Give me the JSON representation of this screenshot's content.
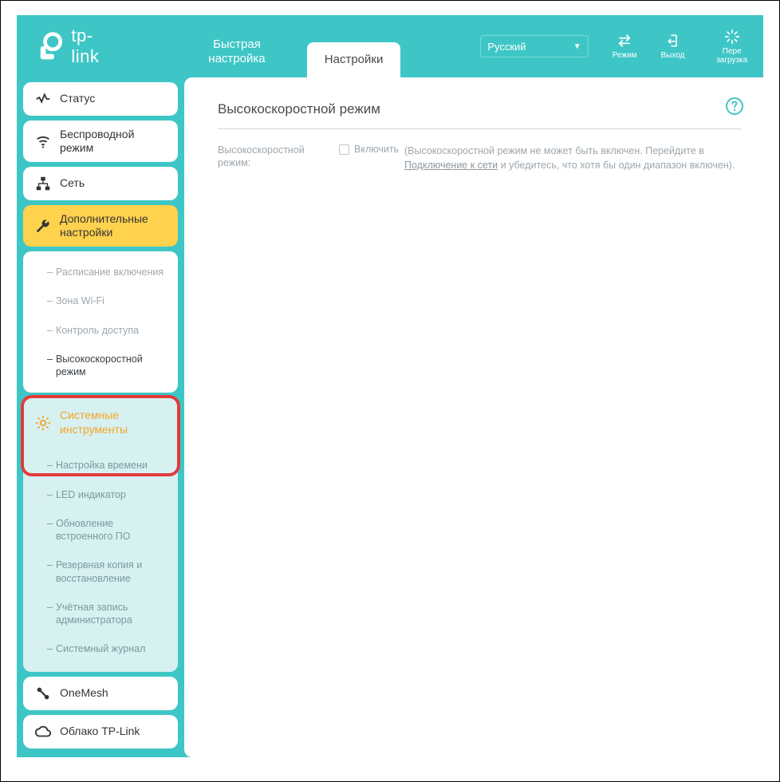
{
  "header": {
    "logo_text": "tp-link",
    "tabs": {
      "quick": "Быстрая настройка",
      "settings": "Настройки"
    },
    "language": "Русский",
    "icons": {
      "mode": "Режим",
      "logout": "Выход",
      "reboot": "Пере загрузка"
    }
  },
  "sidebar": {
    "status": "Статус",
    "wireless": "Беспроводной режим",
    "network": "Сеть",
    "advanced": "Дополнительные настройки",
    "advanced_items": {
      "schedule": "Расписание включения",
      "wifizone": "Зона Wi-Fi",
      "access": "Контроль доступа",
      "highspeed": "Высокоскоростной режим"
    },
    "systools": "Системные инструменты",
    "systools_items": {
      "time": "Настройка времени",
      "led": "LED индикатор",
      "firmware": "Обновление встроенного ПО",
      "backup": "Резервная копия и восстановление",
      "admin": "Учётная запись администратора",
      "syslog": "Системный журнал"
    },
    "onemesh": "OneMesh",
    "cloud": "Облако TP-Link"
  },
  "content": {
    "title": "Высокоскоростной режим",
    "form_label": "Высокоскоростной режим:",
    "enable": "Включить",
    "note_pre": "(Высокоскоростной режим не может быть включен. Перейдите в ",
    "note_link": "Подключение к сети",
    "note_post": " и убедитесь, что хотя бы один диапазон включен)."
  }
}
